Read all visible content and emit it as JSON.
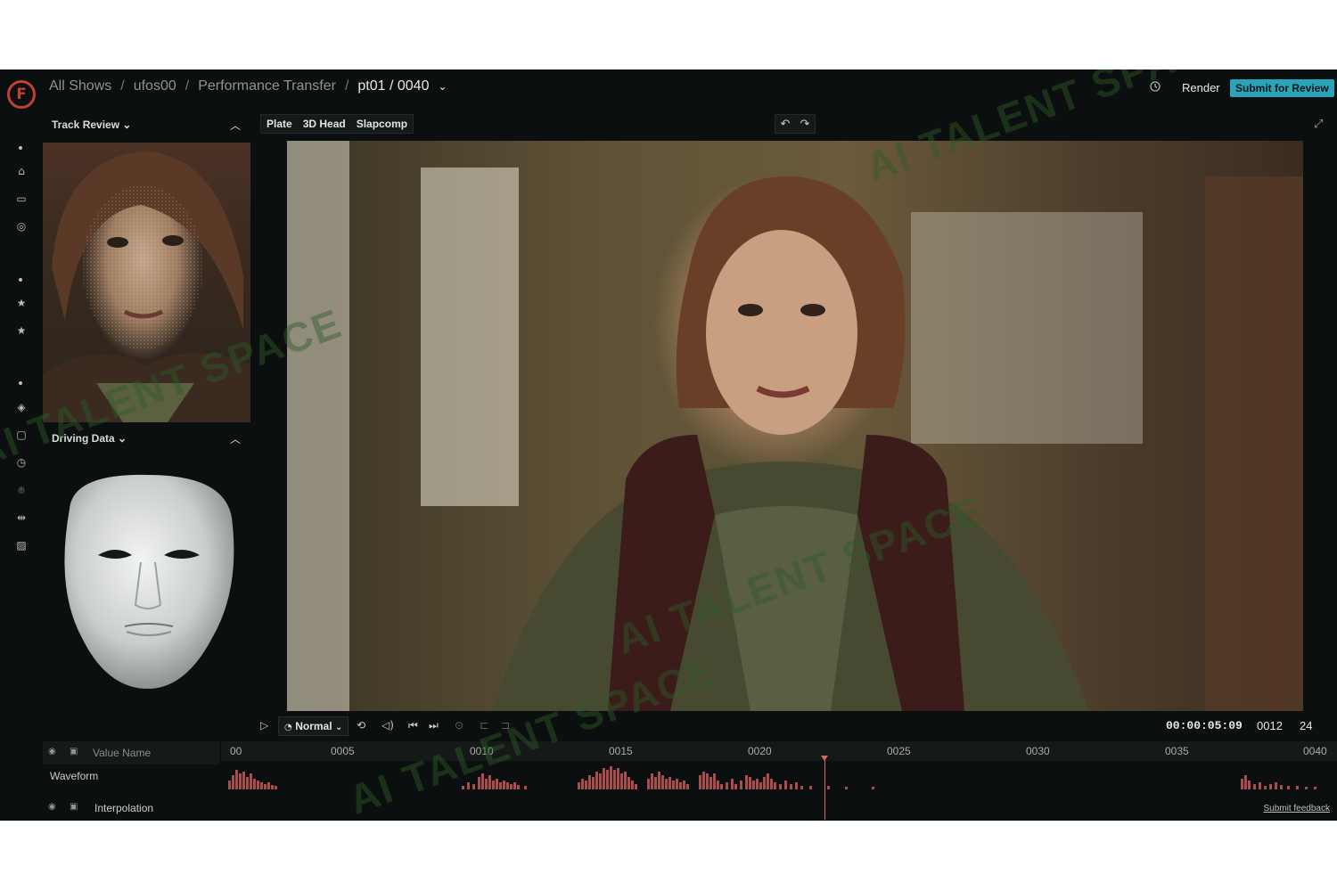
{
  "breadcrumb": {
    "items": [
      "All Shows",
      "ufos00",
      "Performance Transfer"
    ],
    "separator": "/",
    "current": "pt01 / 0040",
    "current_caret": "⌄"
  },
  "header": {
    "logo": "F",
    "history_icon": "history-icon",
    "render_label": "Render",
    "submit_label": "Submit for Review"
  },
  "left_panels": {
    "track_review": {
      "title": "Track Review ⌄",
      "collapse": "︿"
    },
    "driving_data": {
      "title": "Driving Data ⌄",
      "collapse": "︿"
    }
  },
  "viewer": {
    "tabs": [
      "Plate",
      "3D Head",
      "Slapcomp"
    ],
    "undo_icon": "↶",
    "redo_icon": "↷",
    "expand_icon": "⤢"
  },
  "transport": {
    "speed": "Normal",
    "timecode": "00:00:05:09",
    "frame": "0012",
    "fps": "24"
  },
  "timeline": {
    "value_name_header": "Value Name",
    "tracks": [
      "Waveform",
      "Interpolation"
    ],
    "ticks": [
      "00",
      "0005",
      "0010",
      "0015",
      "0020",
      "0025",
      "0030",
      "0035",
      "0040"
    ],
    "feedback_label": "Submit feedback"
  },
  "watermark": "AI TALENT SPACE",
  "colors": {
    "accent": "#2aa4b8",
    "logo": "#c2402e",
    "waveform": "#c55a5a",
    "playhead": "#d46a5f"
  }
}
